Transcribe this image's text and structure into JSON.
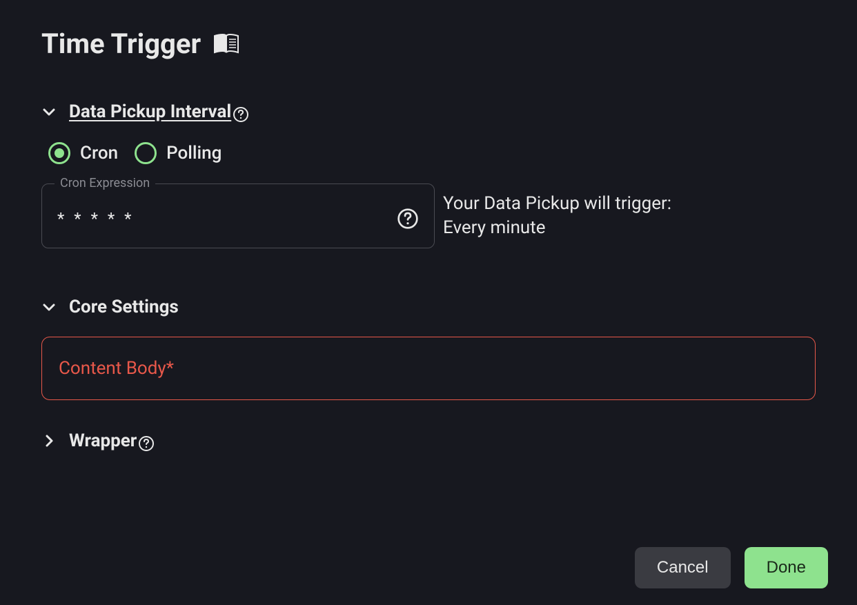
{
  "header": {
    "title": "Time Trigger"
  },
  "sections": {
    "data_pickup": {
      "label": "Data Pickup Interval",
      "radios": {
        "cron": "Cron",
        "polling": "Polling"
      },
      "cron_field": {
        "legend": "Cron Expression",
        "value": "* * * * *"
      },
      "trigger_info_line1": "Your Data Pickup will trigger:",
      "trigger_info_line2": "Every minute"
    },
    "core": {
      "label": "Core Settings",
      "content_body_label": "Content Body*"
    },
    "wrapper": {
      "label": "Wrapper"
    }
  },
  "buttons": {
    "cancel": "Cancel",
    "done": "Done"
  }
}
